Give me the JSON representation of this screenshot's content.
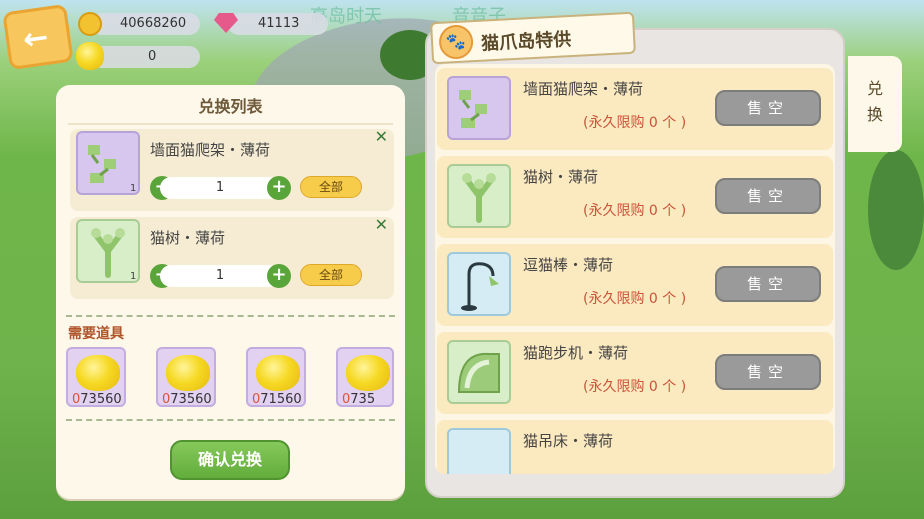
{
  "background": {
    "overlay_text_1": "高岛时天",
    "overlay_text_2": "音音子"
  },
  "resources": {
    "coins": "40668260",
    "gems": "41113",
    "puffs": "0"
  },
  "exchange": {
    "title": "兑换列表",
    "items": [
      {
        "name": "墙面猫爬架・薄荷",
        "qty": "1",
        "owned": "1",
        "all_label": "全部"
      },
      {
        "name": "猫树・薄荷",
        "qty": "1",
        "owned": "1",
        "all_label": "全部"
      }
    ],
    "needs_title": "需要道具",
    "needs": [
      {
        "have": "0",
        "need": "73560"
      },
      {
        "have": "0",
        "need": "73560"
      },
      {
        "have": "0",
        "need": "71560"
      },
      {
        "have": "0",
        "need": "735"
      }
    ],
    "confirm_label": "确认兑换"
  },
  "shop": {
    "title": "猫爪岛特供",
    "rows": [
      {
        "name": "墙面猫爬架・薄荷",
        "limit": "(永久限购  0 个 )",
        "button": "售空"
      },
      {
        "name": "猫树・薄荷",
        "limit": "(永久限购  0 个 )",
        "button": "售空"
      },
      {
        "name": "逗猫棒・薄荷",
        "limit": "(永久限购  0 个 )",
        "button": "售空"
      },
      {
        "name": "猫跑步机・薄荷",
        "limit": "(永久限购  0 个 )",
        "button": "售空"
      },
      {
        "name": "猫吊床・薄荷",
        "limit": "",
        "button": ""
      }
    ]
  },
  "side_tab": {
    "label": "兑换"
  },
  "icons": [
    "back-arrow-icon",
    "coin-icon",
    "gem-icon",
    "puff-icon",
    "paw-icon",
    "minus-icon",
    "plus-icon",
    "close-icon"
  ]
}
